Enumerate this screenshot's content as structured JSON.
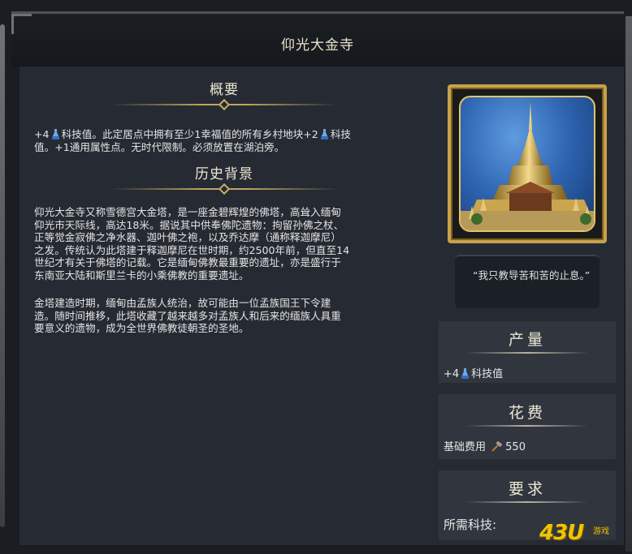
{
  "window": {
    "title": "仰光大金寺"
  },
  "overview": {
    "heading": "概要",
    "line1_a": "+4",
    "line1_b": "科技值。此定居点中拥有至少1幸福值的所有乡村地块+2",
    "line1_c": "科技",
    "line2": "值。+1通用属性点。无时代限制。必须放置在湖泊旁。"
  },
  "history": {
    "heading": "历史背景",
    "p1_lines": [
      "仰光大金寺又称雪德宫大金塔，是一座金碧辉煌的佛塔，高耸入缅甸",
      "仰光市天际线，高达18米。据说其中供奉佛陀遗物：拘留孙佛之杖、",
      "正等觉金寂佛之净水器、迦叶佛之袍，以及乔达摩（通称释迦摩尼）",
      "之发。传统认为此塔建于释迦摩尼在世时期，约2500年前，但直至14",
      "世纪才有关于佛塔的记载。它是缅甸佛教最重要的遗址，亦是盛行于",
      "东南亚大陆和斯里兰卡的小乘佛教的重要遗址。"
    ],
    "p2_lines": [
      "金塔建造时期，缅甸由孟族人统治，故可能由一位孟族国王下令建",
      "造。随时间推移，此塔收藏了越来越多对孟族人和后来的缅族人具重",
      "要意义的遗物，成为全世界佛教徒朝圣的圣地。"
    ]
  },
  "quote": {
    "text": "“我只教导苦和苦的止息。”"
  },
  "yield_panel": {
    "heading": "产量",
    "amount": "+4",
    "label": "科技值"
  },
  "cost_panel": {
    "heading": "花费",
    "label": "基础费用",
    "value": "550"
  },
  "requirement_panel": {
    "heading": "要求",
    "label": "所需科技:"
  },
  "watermark": {
    "brand": "43U",
    "sub": "游戏"
  },
  "colors": {
    "gold": "#c7a24a",
    "science": "#6fa8e8",
    "panel": "#31363e",
    "background": "#262b33"
  }
}
